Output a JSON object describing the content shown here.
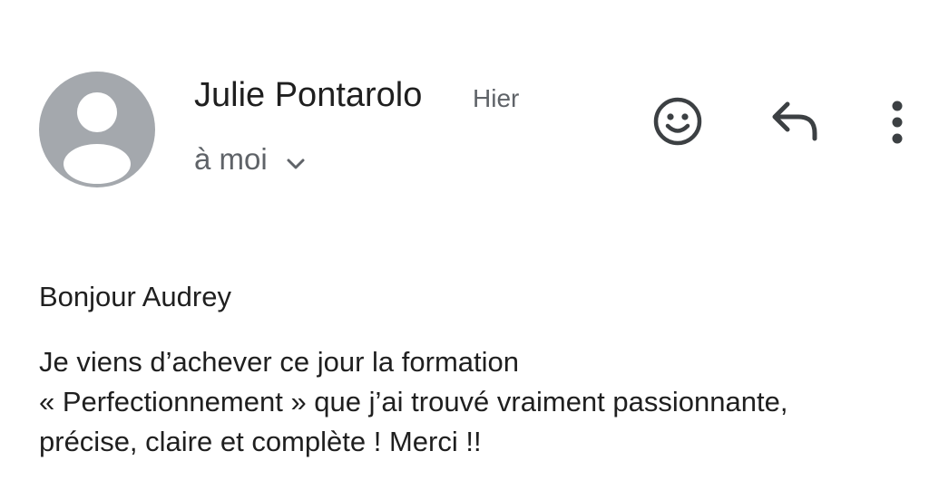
{
  "header": {
    "sender_name": "Julie Pontarolo",
    "date": "Hier",
    "recipient": "à moi",
    "avatar_icon": "person-icon",
    "actions": {
      "emoji_icon": "smiley-icon",
      "reply_icon": "reply-icon",
      "more_icon": "more-vert-icon"
    }
  },
  "body": {
    "greeting": "Bonjour Audrey",
    "lines": [
      "Je viens d’achever ce jour la formation",
      "« Perfectionnement » que j’ai trouvé vraiment passionnante,",
      "précise, claire et complète ! Merci !!"
    ]
  },
  "colors": {
    "avatar_bg": "#a4a8ad",
    "text_primary": "#1f1f1f",
    "text_secondary": "#5f6368",
    "icon": "#3c4043"
  }
}
